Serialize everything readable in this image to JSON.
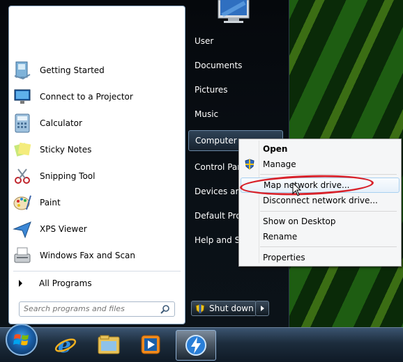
{
  "start_menu": {
    "programs": [
      {
        "label": "Getting Started",
        "icon": "getting-started-icon"
      },
      {
        "label": "Connect to a Projector",
        "icon": "projector-icon"
      },
      {
        "label": "Calculator",
        "icon": "calculator-icon"
      },
      {
        "label": "Sticky Notes",
        "icon": "sticky-notes-icon"
      },
      {
        "label": "Snipping Tool",
        "icon": "scissors-icon"
      },
      {
        "label": "Paint",
        "icon": "paint-palette-icon"
      },
      {
        "label": "XPS Viewer",
        "icon": "xps-viewer-icon"
      },
      {
        "label": "Windows Fax and Scan",
        "icon": "fax-icon"
      }
    ],
    "all_programs_label": "All Programs",
    "search_placeholder": "Search programs and files",
    "right_items": [
      {
        "label": "User"
      },
      {
        "label": "Documents"
      },
      {
        "label": "Pictures"
      },
      {
        "label": "Music"
      },
      {
        "label": "Computer"
      },
      {
        "label": "Control Pan"
      },
      {
        "label": "Devices and"
      },
      {
        "label": "Default Prog"
      },
      {
        "label": "Help and Su"
      }
    ],
    "shutdown_label": "Shut down"
  },
  "context_menu": {
    "items": [
      {
        "label": "Open",
        "bold": true
      },
      {
        "label": "Manage",
        "icon": "uac-shield-icon"
      },
      {
        "label": "Map network drive...",
        "highlighted": true
      },
      {
        "label": "Disconnect network drive..."
      },
      {
        "label": "Show on Desktop"
      },
      {
        "label": "Rename"
      },
      {
        "label": "Properties"
      }
    ]
  },
  "taskbar": {
    "items": [
      {
        "name": "internet-explorer-icon"
      },
      {
        "name": "windows-explorer-icon"
      },
      {
        "name": "media-player-icon"
      },
      {
        "name": "pinned-app-icon",
        "active": true
      }
    ]
  },
  "colors": {
    "annotation": "#d8222a",
    "highlight_border": "#a8d0f0"
  }
}
